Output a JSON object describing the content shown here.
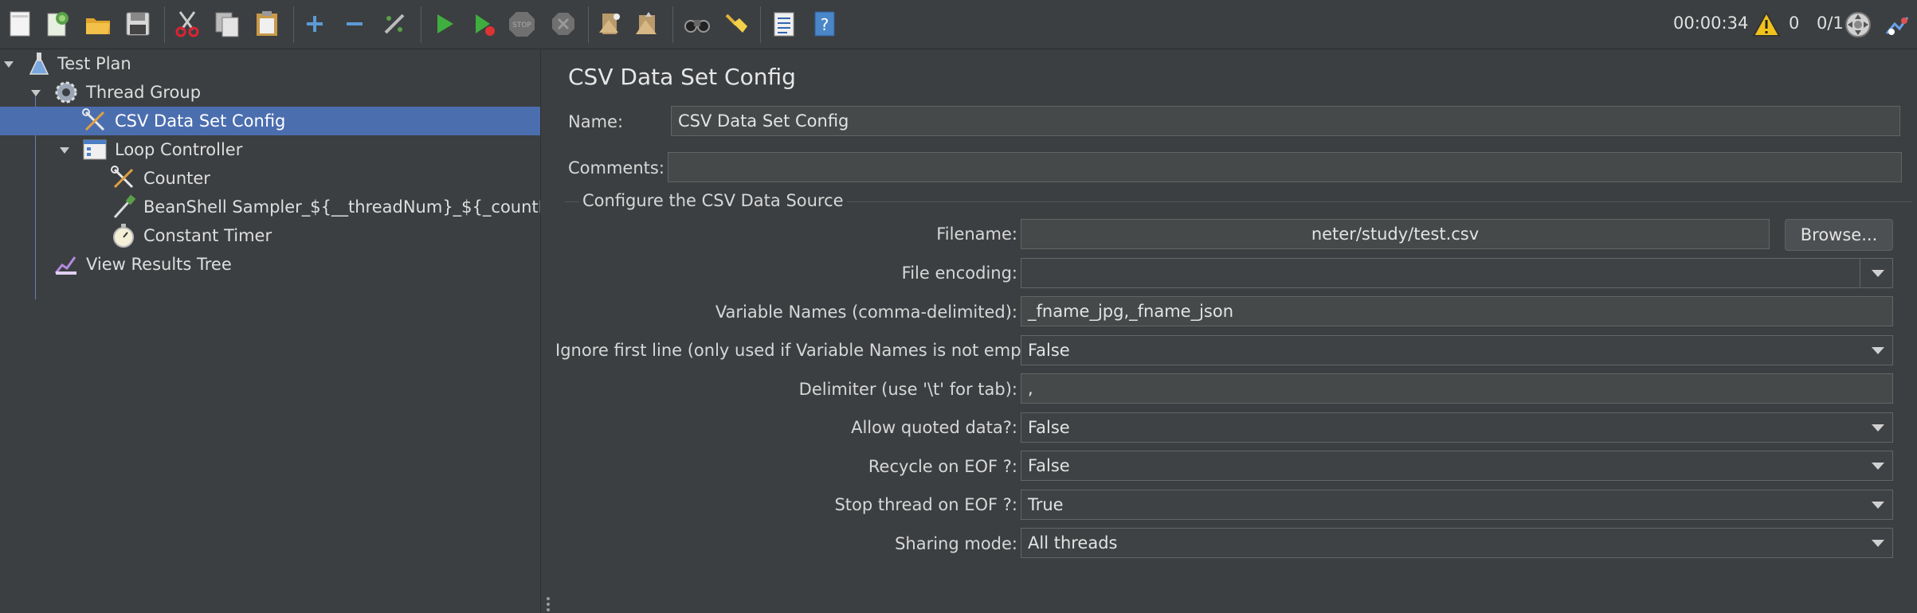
{
  "toolbar": {
    "timer": "00:00:34",
    "warnings": "0",
    "threads": "0/1",
    "icons": [
      "new-icon",
      "templates-icon",
      "open-icon",
      "save-icon",
      "cut-icon",
      "copy-icon",
      "paste-icon",
      "expand-icon",
      "collapse-icon",
      "toggle-icon",
      "start-icon",
      "start-no-pause-icon",
      "stop-icon",
      "shutdown-icon",
      "clear-icon",
      "clear-all-icon",
      "search-icon",
      "reset-search-icon",
      "function-helper-icon",
      "help-icon",
      "warning-icon",
      "remote-icon",
      "log-viewer-icon"
    ]
  },
  "tree": {
    "items": [
      {
        "label": "Test Plan",
        "icon": "flask-icon"
      },
      {
        "label": "Thread Group",
        "icon": "gear-icon"
      },
      {
        "label": "CSV Data Set Config",
        "icon": "wrench-icon"
      },
      {
        "label": "Loop Controller",
        "icon": "controller-icon"
      },
      {
        "label": "Counter",
        "icon": "wrench-icon"
      },
      {
        "label": "BeanShell Sampler_${__threadNum}_${_countN}",
        "icon": "pipette-icon"
      },
      {
        "label": "Constant Timer",
        "icon": "stopwatch-icon"
      },
      {
        "label": "View Results Tree",
        "icon": "chart-icon"
      }
    ]
  },
  "panel": {
    "title": "CSV Data Set Config",
    "name_label": "Name:",
    "name_value": "CSV Data Set Config",
    "comments_label": "Comments:",
    "comments_value": "",
    "section_title": "Configure the CSV Data Source",
    "browse_label": "Browse...",
    "fields": {
      "filename": {
        "label": "Filename:",
        "value": "neter/study/test.csv"
      },
      "encoding": {
        "label": "File encoding:",
        "value": ""
      },
      "varnames": {
        "label": "Variable Names (comma-delimited):",
        "value": "_fname_jpg,_fname_json"
      },
      "ignore_first": {
        "label": "Ignore first line (only used if Variable Names is not empty):",
        "value": "False"
      },
      "delimiter": {
        "label": "Delimiter (use '\\t' for tab):",
        "value": ","
      },
      "quoted": {
        "label": "Allow quoted data?:",
        "value": "False"
      },
      "recycle": {
        "label": "Recycle on EOF ?:",
        "value": "False"
      },
      "stop_thread": {
        "label": "Stop thread on EOF ?:",
        "value": "True"
      },
      "sharing": {
        "label": "Sharing mode:",
        "value": "All threads"
      }
    }
  }
}
